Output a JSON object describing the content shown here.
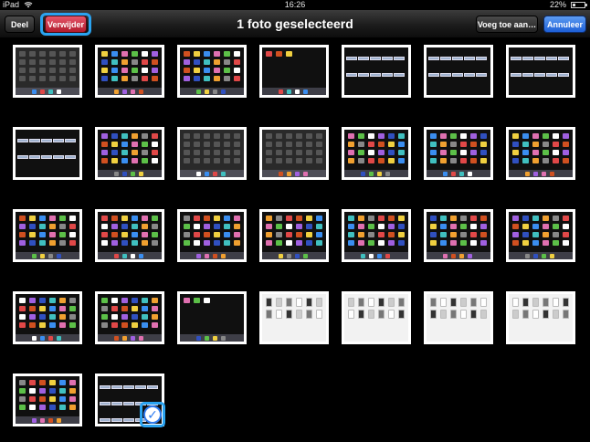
{
  "status_bar": {
    "device": "iPad",
    "time": "16:26",
    "battery": "22%"
  },
  "toolbar": {
    "share_label": "Deel",
    "delete_label": "Verwijder",
    "title": "1 foto geselecteerd",
    "add_to_label": "Voeg toe aan…",
    "cancel_label": "Annuleer"
  },
  "photos": {
    "count": 30,
    "selected_index": 29
  },
  "colors": {
    "delete": "#c8283c",
    "cancel": "#2f7cf0",
    "highlight": "#2aa3f0"
  }
}
